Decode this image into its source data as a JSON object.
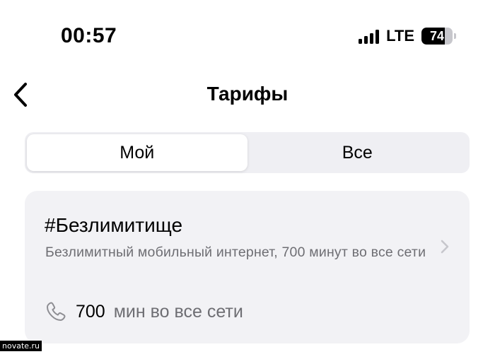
{
  "status_bar": {
    "time": "00:57",
    "network": "LTE",
    "battery_percent": "74",
    "battery_level": 0.74,
    "signal_icon": "cellular-signal-icon",
    "battery_icon": "battery-icon"
  },
  "nav": {
    "back_icon": "chevron-left-icon",
    "title": "Тарифы"
  },
  "segmented": {
    "options": [
      {
        "label": "Мой",
        "selected": true
      },
      {
        "label": "Все",
        "selected": false
      }
    ]
  },
  "tariff_card": {
    "title": "#Безлимитище",
    "description": "Безлимитный мобильный интернет, 700 минут во все сети",
    "chevron_icon": "chevron-right-icon",
    "feature": {
      "icon": "phone-icon",
      "value": "700",
      "label": "мин во все сети"
    }
  },
  "watermark": "novate.ru",
  "colors": {
    "secondary_text": "#6e6e73",
    "card_background": "#f2f2f5",
    "segmented_background": "#efeff3",
    "chevron": "#c7c7cc"
  }
}
